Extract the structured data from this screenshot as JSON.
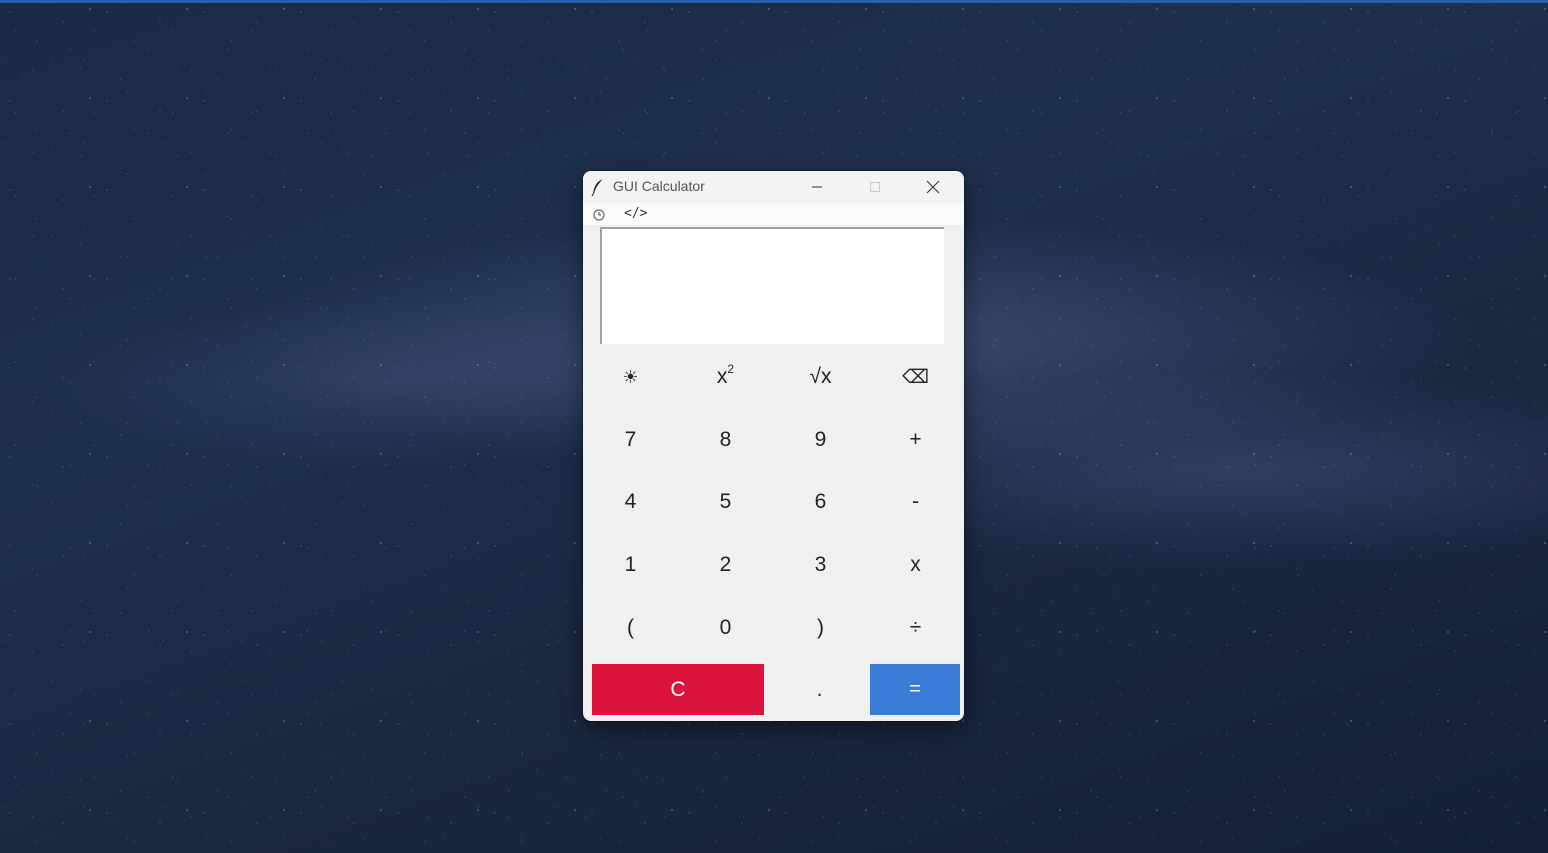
{
  "window": {
    "title": "GUI Calculator",
    "title_icon": "feather-icon",
    "controls": {
      "minimize_icon": "minimize-icon",
      "maximize_icon": "maximize-icon",
      "close_icon": "close-icon"
    }
  },
  "menubar": {
    "history_icon": "history-icon",
    "code_label": "</>"
  },
  "display": {
    "value": ""
  },
  "keys": {
    "row1": {
      "theme": "☀",
      "square_base": "x",
      "square_exp": "2",
      "sqrt": "√x",
      "backspace": "⌫"
    },
    "row2": [
      "7",
      "8",
      "9",
      "+"
    ],
    "row3": [
      "4",
      "5",
      "6",
      "-"
    ],
    "row4": [
      "1",
      "2",
      "3",
      "x"
    ],
    "row5": [
      "(",
      "0",
      ")",
      "÷"
    ],
    "row6": {
      "clear": "C",
      "dot": ".",
      "equals": "="
    }
  },
  "colors": {
    "clear_bg": "#dc143c",
    "equals_bg": "#3a7bd5",
    "window_bg": "#f0f0f0"
  }
}
